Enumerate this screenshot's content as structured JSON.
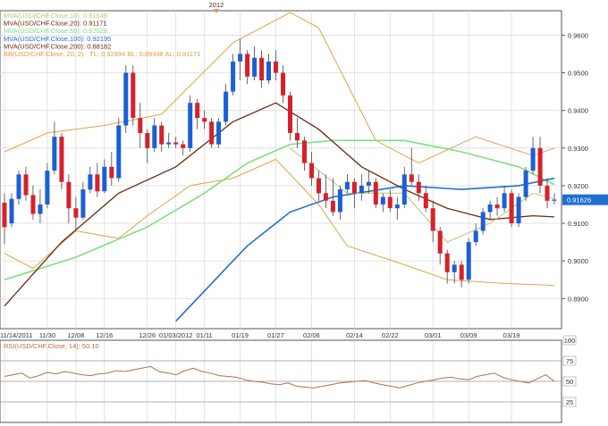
{
  "chart_data": {
    "type": "candlestick",
    "year_marker": "2012",
    "x_tick_labels": [
      "11/14/2011",
      "11/30",
      "12/08",
      "12/16",
      "12/26",
      "01/03/2012",
      "01/11",
      "01/19",
      "01/27",
      "02/06",
      "02/14",
      "02/22",
      "03/01",
      "03/09",
      "03/19"
    ],
    "y_tick_labels": [
      "0.9600",
      "0.9500",
      "0.9400",
      "0.9300",
      "0.9200",
      "0.9100",
      "0.9000",
      "0.8900"
    ],
    "ylim": [
      0.882,
      0.9665
    ],
    "last_price_label": "0.91626",
    "legend": [
      {
        "text": "MVA(USD/CHF.Close,10): 0.91649",
        "color": "#b8c878"
      },
      {
        "text": "MVA(USD/CHF.Close,20): 0.91171",
        "color": "#6b2a12"
      },
      {
        "text": "MVA(USD/CHF.Close,50): 0.92028",
        "color": "#7ee07e"
      },
      {
        "text": "MVA(USD/CHF.Close,100): 0.92195",
        "color": "#1f6fd0"
      },
      {
        "text": "MVA(USD/CHF.Close,200): 0.88182",
        "color": "#6b2a12"
      },
      {
        "text": "BB(USD/CHF.Close, 20, 2) · TL: 0.92994  BL: 0.89348  AL: 0.91171",
        "color": "#e39a3c"
      }
    ],
    "candles": [
      [
        0.9155,
        0.918,
        0.9045,
        0.909
      ],
      [
        0.91,
        0.918,
        0.909,
        0.9165
      ],
      [
        0.9165,
        0.924,
        0.915,
        0.923
      ],
      [
        0.923,
        0.925,
        0.916,
        0.9175
      ],
      [
        0.9175,
        0.92,
        0.911,
        0.9125
      ],
      [
        0.9125,
        0.919,
        0.91,
        0.915
      ],
      [
        0.915,
        0.926,
        0.914,
        0.924
      ],
      [
        0.924,
        0.937,
        0.923,
        0.933
      ],
      [
        0.933,
        0.934,
        0.919,
        0.921
      ],
      [
        0.921,
        0.923,
        0.91,
        0.914
      ],
      [
        0.914,
        0.917,
        0.908,
        0.9115
      ],
      [
        0.9115,
        0.921,
        0.911,
        0.919
      ],
      [
        0.919,
        0.925,
        0.918,
        0.923
      ],
      [
        0.923,
        0.926,
        0.917,
        0.9185
      ],
      [
        0.9185,
        0.927,
        0.918,
        0.925
      ],
      [
        0.925,
        0.929,
        0.92,
        0.922
      ],
      [
        0.922,
        0.938,
        0.921,
        0.936
      ],
      [
        0.936,
        0.952,
        0.934,
        0.95
      ],
      [
        0.95,
        0.952,
        0.936,
        0.938
      ],
      [
        0.938,
        0.942,
        0.93,
        0.934
      ],
      [
        0.934,
        0.935,
        0.926,
        0.93
      ],
      [
        0.93,
        0.938,
        0.929,
        0.936
      ],
      [
        0.936,
        0.937,
        0.929,
        0.931
      ],
      [
        0.931,
        0.934,
        0.93,
        0.9315
      ],
      [
        0.9315,
        0.933,
        0.93,
        0.931
      ],
      [
        0.931,
        0.932,
        0.928,
        0.93
      ],
      [
        0.93,
        0.944,
        0.929,
        0.942
      ],
      [
        0.942,
        0.943,
        0.935,
        0.938
      ],
      [
        0.938,
        0.94,
        0.935,
        0.937
      ],
      [
        0.937,
        0.938,
        0.93,
        0.931
      ],
      [
        0.931,
        0.938,
        0.93,
        0.937
      ],
      [
        0.937,
        0.947,
        0.936,
        0.945
      ],
      [
        0.945,
        0.955,
        0.944,
        0.953
      ],
      [
        0.953,
        0.959,
        0.948,
        0.955
      ],
      [
        0.955,
        0.956,
        0.947,
        0.949
      ],
      [
        0.949,
        0.957,
        0.948,
        0.954
      ],
      [
        0.954,
        0.956,
        0.946,
        0.948
      ],
      [
        0.948,
        0.955,
        0.947,
        0.953
      ],
      [
        0.953,
        0.956,
        0.948,
        0.95
      ],
      [
        0.95,
        0.952,
        0.942,
        0.944
      ],
      [
        0.944,
        0.945,
        0.932,
        0.934
      ],
      [
        0.934,
        0.938,
        0.93,
        0.932
      ],
      [
        0.932,
        0.933,
        0.924,
        0.926
      ],
      [
        0.926,
        0.929,
        0.92,
        0.922
      ],
      [
        0.922,
        0.924,
        0.916,
        0.918
      ],
      [
        0.918,
        0.923,
        0.914,
        0.916
      ],
      [
        0.916,
        0.922,
        0.912,
        0.913
      ],
      [
        0.913,
        0.92,
        0.911,
        0.919
      ],
      [
        0.919,
        0.923,
        0.918,
        0.921
      ],
      [
        0.921,
        0.922,
        0.914,
        0.918
      ],
      [
        0.918,
        0.923,
        0.916,
        0.92
      ],
      [
        0.92,
        0.924,
        0.918,
        0.921
      ],
      [
        0.921,
        0.922,
        0.914,
        0.915
      ],
      [
        0.915,
        0.918,
        0.913,
        0.917
      ],
      [
        0.917,
        0.919,
        0.913,
        0.914
      ],
      [
        0.914,
        0.917,
        0.911,
        0.915
      ],
      [
        0.915,
        0.925,
        0.914,
        0.923
      ],
      [
        0.923,
        0.93,
        0.92,
        0.921
      ],
      [
        0.921,
        0.923,
        0.916,
        0.918
      ],
      [
        0.918,
        0.92,
        0.913,
        0.914
      ],
      [
        0.914,
        0.916,
        0.905,
        0.908
      ],
      [
        0.908,
        0.909,
        0.899,
        0.902
      ],
      [
        0.902,
        0.903,
        0.894,
        0.897
      ],
      [
        0.897,
        0.9,
        0.894,
        0.899
      ],
      [
        0.899,
        0.9,
        0.893,
        0.895
      ],
      [
        0.895,
        0.906,
        0.894,
        0.905
      ],
      [
        0.905,
        0.91,
        0.904,
        0.908
      ],
      [
        0.908,
        0.914,
        0.907,
        0.913
      ],
      [
        0.913,
        0.916,
        0.911,
        0.915
      ],
      [
        0.915,
        0.917,
        0.912,
        0.914
      ],
      [
        0.914,
        0.92,
        0.913,
        0.918
      ],
      [
        0.918,
        0.919,
        0.909,
        0.91
      ],
      [
        0.91,
        0.918,
        0.909,
        0.917
      ],
      [
        0.917,
        0.925,
        0.916,
        0.924
      ],
      [
        0.924,
        0.933,
        0.923,
        0.93
      ],
      [
        0.93,
        0.933,
        0.918,
        0.92
      ],
      [
        0.92,
        0.922,
        0.914,
        0.916
      ],
      [
        0.916,
        0.918,
        0.915,
        0.9163
      ]
    ],
    "bb_upper": [
      [
        0,
        0.929
      ],
      [
        6,
        0.934
      ],
      [
        14,
        0.936
      ],
      [
        22,
        0.939
      ],
      [
        32,
        0.958
      ],
      [
        40,
        0.966
      ],
      [
        44,
        0.962
      ],
      [
        52,
        0.932
      ],
      [
        58,
        0.926
      ],
      [
        66,
        0.933
      ],
      [
        74,
        0.928
      ],
      [
        77,
        0.93
      ]
    ],
    "bb_lower": [
      [
        0,
        0.902
      ],
      [
        4,
        0.898
      ],
      [
        10,
        0.908
      ],
      [
        16,
        0.906
      ],
      [
        20,
        0.912
      ],
      [
        26,
        0.92
      ],
      [
        32,
        0.922
      ],
      [
        38,
        0.927
      ],
      [
        44,
        0.915
      ],
      [
        48,
        0.904
      ],
      [
        56,
        0.899
      ],
      [
        62,
        0.895
      ],
      [
        70,
        0.894
      ],
      [
        77,
        0.8935
      ]
    ],
    "mva20": [
      [
        0,
        0.888
      ],
      [
        8,
        0.905
      ],
      [
        16,
        0.918
      ],
      [
        24,
        0.925
      ],
      [
        32,
        0.937
      ],
      [
        38,
        0.942
      ],
      [
        44,
        0.935
      ],
      [
        50,
        0.925
      ],
      [
        56,
        0.919
      ],
      [
        62,
        0.914
      ],
      [
        68,
        0.911
      ],
      [
        74,
        0.912
      ],
      [
        77,
        0.9117
      ]
    ],
    "mva50": [
      [
        0,
        0.895
      ],
      [
        10,
        0.901
      ],
      [
        20,
        0.909
      ],
      [
        28,
        0.918
      ],
      [
        34,
        0.926
      ],
      [
        40,
        0.931
      ],
      [
        46,
        0.932
      ],
      [
        56,
        0.932
      ],
      [
        64,
        0.929
      ],
      [
        72,
        0.925
      ],
      [
        77,
        0.9203
      ]
    ],
    "mva100": [
      [
        24,
        0.884
      ],
      [
        28,
        0.892
      ],
      [
        34,
        0.904
      ],
      [
        40,
        0.913
      ],
      [
        46,
        0.917
      ],
      [
        56,
        0.92
      ],
      [
        64,
        0.919
      ],
      [
        72,
        0.92
      ],
      [
        77,
        0.922
      ]
    ],
    "mva10": [
      [
        40,
        0.93
      ],
      [
        48,
        0.918
      ],
      [
        56,
        0.918
      ],
      [
        62,
        0.905
      ],
      [
        68,
        0.91
      ],
      [
        74,
        0.918
      ],
      [
        77,
        0.9165
      ]
    ],
    "rsi": {
      "label": "RSI(USD/CHF.Close, 14): 50.10",
      "ticks": [
        "100",
        "75",
        "50",
        "25"
      ],
      "levels": [
        75,
        50,
        25
      ],
      "values": [
        56,
        58,
        60,
        54,
        57,
        61,
        59,
        62,
        60,
        58,
        57,
        59,
        60,
        63,
        62,
        64,
        66,
        68,
        62,
        60,
        58,
        63,
        66,
        62,
        60,
        57,
        56,
        55,
        52,
        50,
        49,
        47,
        46,
        48,
        44,
        43,
        42,
        44,
        46,
        48,
        49,
        50,
        51,
        48,
        46,
        44,
        42,
        45,
        48,
        50,
        52,
        54,
        55,
        53,
        52,
        56,
        58,
        60,
        55,
        52,
        50,
        48,
        53,
        58,
        50
      ]
    }
  }
}
